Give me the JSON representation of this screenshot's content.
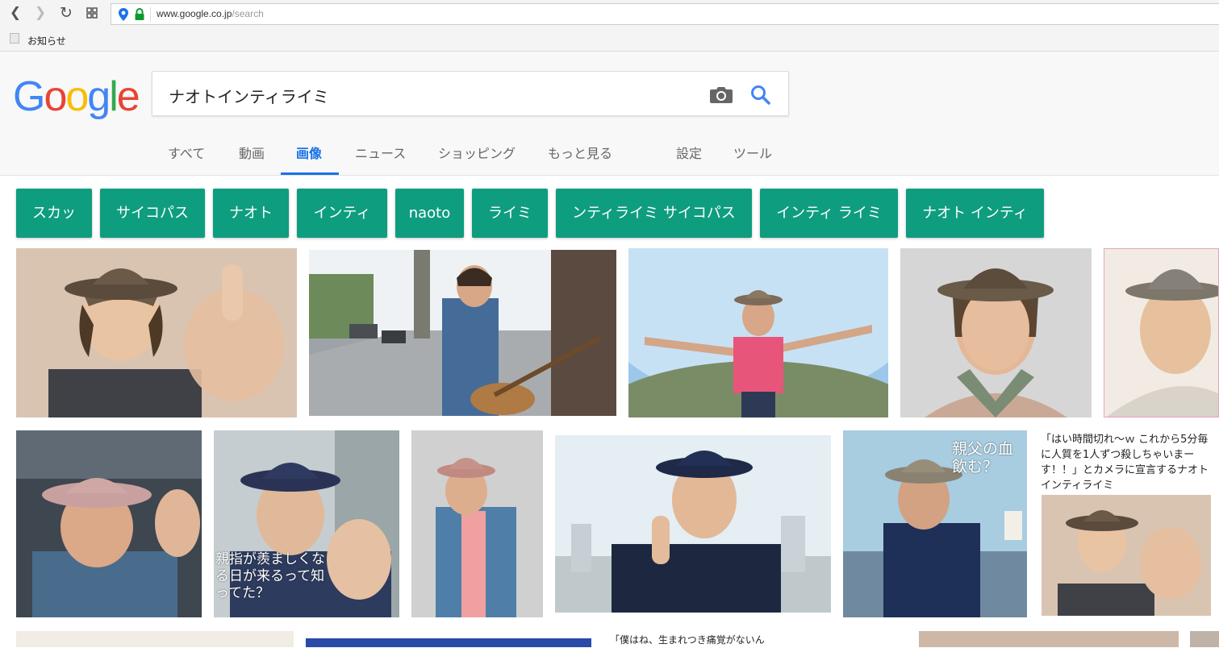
{
  "browser": {
    "url_host": "www.google.co.jp",
    "url_path": "/search",
    "bookmark": "お知らせ"
  },
  "logo": {
    "text": "Google",
    "colors": [
      "#4285F4",
      "#EA4335",
      "#FBBC05",
      "#4285F4",
      "#34A853",
      "#EA4335"
    ]
  },
  "search": {
    "query": "ナオトインティライミ"
  },
  "tabs": [
    {
      "label": "すべて"
    },
    {
      "label": "動画"
    },
    {
      "label": "画像"
    },
    {
      "label": "ニュース"
    },
    {
      "label": "ショッピング"
    },
    {
      "label": "もっと見る"
    },
    {
      "label": "設定"
    },
    {
      "label": "ツール"
    }
  ],
  "chips": [
    "スカッ",
    "サイコパス",
    "ナオト",
    "インティ",
    "naoto",
    "ライミ",
    "ンティライミ サイコパス",
    "インティ ライミ",
    "ナオト インティ"
  ],
  "chip_color": "#0f9d80",
  "accent": "#1a73e8",
  "overlays": {
    "thumb_b": "親指が羨ましくなる日が来るって知ってた？",
    "thumb_f": "親父の血飲む？"
  },
  "captions": {
    "card_g": "「はい時間切れ〜ｗ これから5分毎に人質を1人ずつ殺しちゃいまーす！！」とカメラに宣言するナオトインティライミ",
    "row3": "「僕はね、生まれつき痛覚がないん"
  }
}
